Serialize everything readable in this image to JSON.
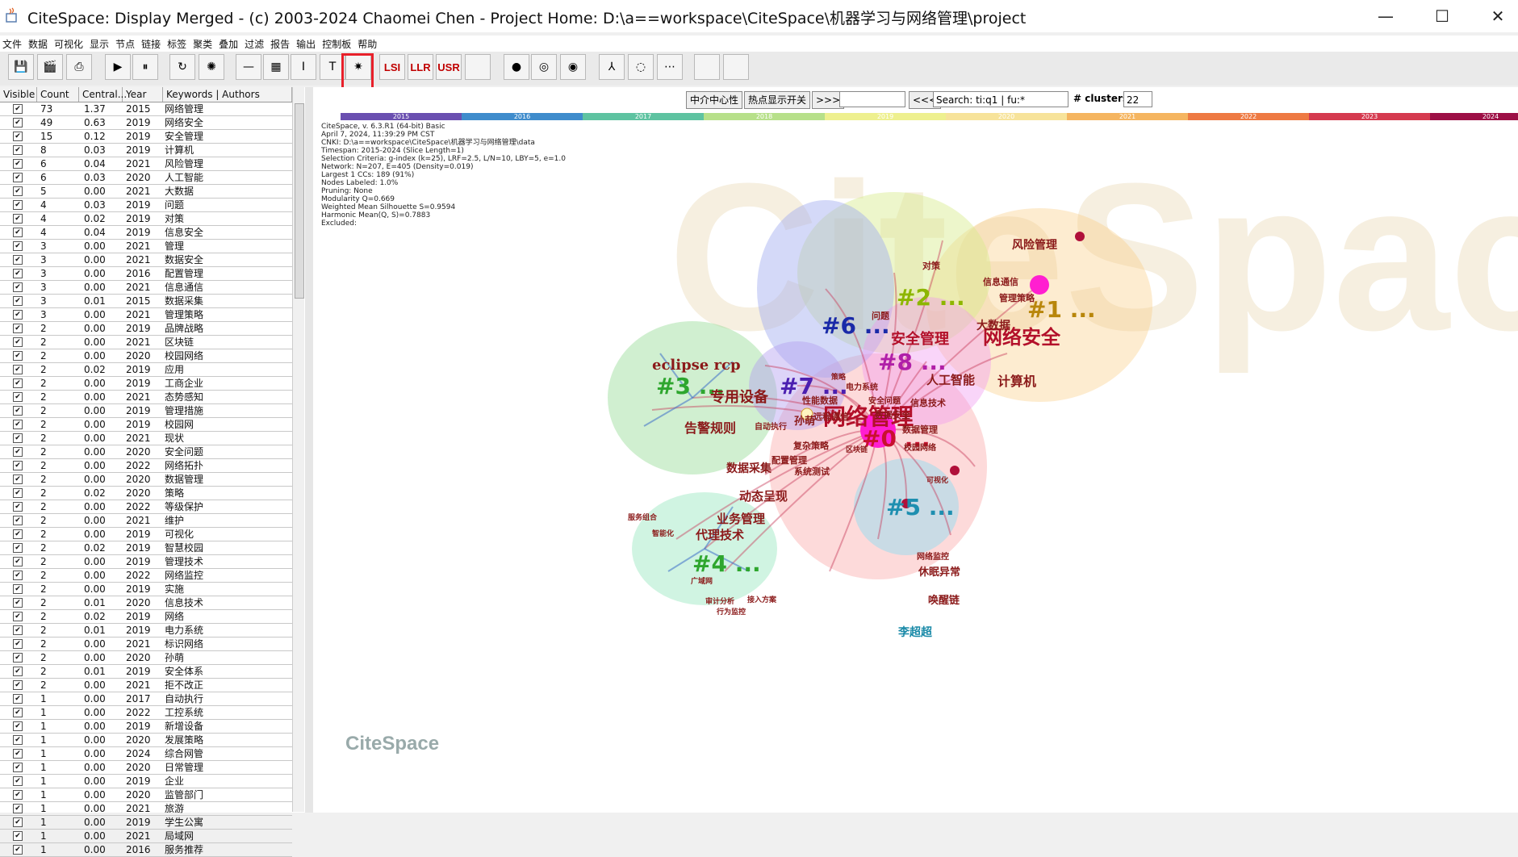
{
  "window": {
    "title": "CiteSpace: Display Merged - (c) 2003-2024 Chaomei Chen - Project Home: D:\\a==workspace\\CiteSpace\\机器学习与网络管理\\project",
    "controls": [
      "—",
      "☐",
      "✕"
    ]
  },
  "menu": [
    "文件",
    "数据",
    "可视化",
    "显示",
    "节点",
    "链接",
    "标签",
    "聚类",
    "叠加",
    "过滤",
    "报告",
    "输出",
    "控制板",
    "帮助"
  ],
  "toolbar": {
    "buttons": [
      {
        "name": "save-icon",
        "label": "💾"
      },
      {
        "name": "movie-icon",
        "label": "🎬"
      },
      {
        "name": "export-pdf-icon",
        "label": "⎙"
      },
      {
        "name": "play-icon",
        "label": "▶"
      },
      {
        "name": "pause-icon",
        "label": "⏸"
      },
      {
        "name": "refresh-icon",
        "label": "↻"
      },
      {
        "name": "starburst-icon",
        "label": "✺"
      },
      {
        "name": "line-icon",
        "label": "—"
      },
      {
        "name": "grid-icon",
        "label": "▦"
      },
      {
        "name": "resize-icon",
        "label": "I"
      },
      {
        "name": "text-icon",
        "label": "T"
      },
      {
        "name": "cluster-icon",
        "label": "✷"
      },
      {
        "name": "lsi-button",
        "label": "LSI"
      },
      {
        "name": "llr-button",
        "label": "LLR"
      },
      {
        "name": "usr-button",
        "label": "USR"
      },
      {
        "name": "blank-icon",
        "label": ""
      },
      {
        "name": "dots-icon",
        "label": "●"
      },
      {
        "name": "chain-icon",
        "label": "◎"
      },
      {
        "name": "target-icon",
        "label": "◉"
      },
      {
        "name": "tree-icon",
        "label": "⅄"
      },
      {
        "name": "spinner-icon",
        "label": "◌"
      },
      {
        "name": "timeline-icon",
        "label": "⋯"
      },
      {
        "name": "blank2-icon",
        "label": ""
      },
      {
        "name": "blank3-icon",
        "label": ""
      }
    ]
  },
  "table": {
    "headers": [
      "Visible",
      "Count",
      "Central...",
      "Year",
      "Keywords | Authors"
    ],
    "rows": [
      [
        "73",
        "1.37",
        "2015",
        "网络管理"
      ],
      [
        "49",
        "0.63",
        "2019",
        "网络安全"
      ],
      [
        "15",
        "0.12",
        "2019",
        "安全管理"
      ],
      [
        "8",
        "0.03",
        "2019",
        "计算机"
      ],
      [
        "6",
        "0.04",
        "2021",
        "风险管理"
      ],
      [
        "6",
        "0.03",
        "2020",
        "人工智能"
      ],
      [
        "5",
        "0.00",
        "2021",
        "大数据"
      ],
      [
        "4",
        "0.03",
        "2019",
        "问题"
      ],
      [
        "4",
        "0.02",
        "2019",
        "对策"
      ],
      [
        "4",
        "0.04",
        "2019",
        "信息安全"
      ],
      [
        "3",
        "0.00",
        "2021",
        "管理"
      ],
      [
        "3",
        "0.00",
        "2021",
        "数据安全"
      ],
      [
        "3",
        "0.00",
        "2016",
        "配置管理"
      ],
      [
        "3",
        "0.00",
        "2021",
        "信息通信"
      ],
      [
        "3",
        "0.01",
        "2015",
        "数据采集"
      ],
      [
        "3",
        "0.00",
        "2021",
        "管理策略"
      ],
      [
        "2",
        "0.00",
        "2019",
        "品牌战略"
      ],
      [
        "2",
        "0.00",
        "2021",
        "区块链"
      ],
      [
        "2",
        "0.00",
        "2020",
        "校园网络"
      ],
      [
        "2",
        "0.02",
        "2019",
        "应用"
      ],
      [
        "2",
        "0.00",
        "2019",
        "工商企业"
      ],
      [
        "2",
        "0.00",
        "2021",
        "态势感知"
      ],
      [
        "2",
        "0.00",
        "2019",
        "管理措施"
      ],
      [
        "2",
        "0.00",
        "2019",
        "校园网"
      ],
      [
        "2",
        "0.00",
        "2021",
        "现状"
      ],
      [
        "2",
        "0.00",
        "2020",
        "安全问题"
      ],
      [
        "2",
        "0.00",
        "2022",
        "网络拓扑"
      ],
      [
        "2",
        "0.00",
        "2020",
        "数据管理"
      ],
      [
        "2",
        "0.02",
        "2020",
        "策略"
      ],
      [
        "2",
        "0.00",
        "2022",
        "等级保护"
      ],
      [
        "2",
        "0.00",
        "2021",
        "维护"
      ],
      [
        "2",
        "0.00",
        "2019",
        "可视化"
      ],
      [
        "2",
        "0.02",
        "2019",
        "智慧校园"
      ],
      [
        "2",
        "0.00",
        "2019",
        "管理技术"
      ],
      [
        "2",
        "0.00",
        "2022",
        "网络监控"
      ],
      [
        "2",
        "0.00",
        "2019",
        "实施"
      ],
      [
        "2",
        "0.01",
        "2020",
        "信息技术"
      ],
      [
        "2",
        "0.02",
        "2019",
        "网络"
      ],
      [
        "2",
        "0.01",
        "2019",
        "电力系统"
      ],
      [
        "2",
        "0.00",
        "2021",
        "标识网络"
      ],
      [
        "2",
        "0.00",
        "2020",
        "孙萌"
      ],
      [
        "2",
        "0.01",
        "2019",
        "安全体系"
      ],
      [
        "2",
        "0.00",
        "2021",
        "拒不改正"
      ],
      [
        "1",
        "0.00",
        "2017",
        "自动执行"
      ],
      [
        "1",
        "0.00",
        "2022",
        "工控系统"
      ],
      [
        "1",
        "0.00",
        "2019",
        "新增设备"
      ],
      [
        "1",
        "0.00",
        "2020",
        "发展策略"
      ],
      [
        "1",
        "0.00",
        "2024",
        "综合网管"
      ],
      [
        "1",
        "0.00",
        "2020",
        "日常管理"
      ],
      [
        "1",
        "0.00",
        "2019",
        "企业"
      ],
      [
        "1",
        "0.00",
        "2020",
        "监管部门"
      ],
      [
        "1",
        "0.00",
        "2021",
        "旅游"
      ],
      [
        "1",
        "0.00",
        "2019",
        "学生公寓"
      ],
      [
        "1",
        "0.00",
        "2021",
        "局域网"
      ],
      [
        "1",
        "0.00",
        "2016",
        "服务推荐"
      ]
    ]
  },
  "search": {
    "betweenness_label": "中介中心性",
    "hotspot_label": "热点显示开关",
    "next_label": ">>>",
    "prev_label": "<<<",
    "search_value": "Search: ti:q1 | fu:*",
    "clusters_label": "# clusters",
    "clusters_value": "22"
  },
  "timeline": {
    "years": [
      "2015",
      "2016",
      "2017",
      "2018",
      "2019",
      "2020",
      "2021",
      "2022",
      "2023",
      "2024"
    ],
    "colors": [
      "#6a4fb0",
      "#3f8ccc",
      "#5ec3a1",
      "#b7e08a",
      "#eef08f",
      "#f7e39a",
      "#f5b560",
      "#ee7a43",
      "#d53a4f",
      "#9d1046"
    ]
  },
  "info_lines": [
    "CiteSpace, v. 6.3.R1 (64-bit) Basic",
    "April 7, 2024, 11:39:29 PM CST",
    "CNKI: D:\\a==workspace\\CiteSpace\\机器学习与网络管理\\data",
    "Timespan: 2015-2024 (Slice Length=1)",
    "Selection Criteria: g-index (k=25), LRF=2.5, L/N=10, LBY=5, e=1.0",
    "Network: N=207, E=405 (Density=0.019)",
    "Largest 1 CCs: 189 (91%)",
    "Nodes Labeled: 1.0%",
    "Pruning: None",
    "Modularity Q=0.669",
    "Weighted Mean Silhouette S=0.9594",
    "Harmonic Mean(Q, S)=0.7883",
    "Excluded:"
  ],
  "clusters": [
    {
      "label": "#0 ...",
      "color": "#c8102e"
    },
    {
      "label": "#1 ...",
      "color": "#b8860b"
    },
    {
      "label": "#2 ...",
      "color": "#8db600"
    },
    {
      "label": "#3 ...",
      "color": "#2ea62e"
    },
    {
      "label": "#4 ...",
      "color": "#2ea62e"
    },
    {
      "label": "#5 ...",
      "color": "#1e8fb0"
    },
    {
      "label": "#6 ...",
      "color": "#1a2aa8"
    },
    {
      "label": "#7 ...",
      "color": "#4b1fb0"
    },
    {
      "label": "#8 ...",
      "color": "#b01fa8"
    }
  ],
  "keywords": [
    "网络管理",
    "网络安全",
    "安全管理",
    "风险管理",
    "计算机",
    "大数据",
    "人工智能",
    "eclipse rcp",
    "专用设备",
    "告警规则",
    "数据采集",
    "动态呈现",
    "业务管理",
    "代理技术",
    "休眠异常",
    "唤醒链",
    "李超超",
    "孙萌",
    "对策",
    "问题",
    "信息通信",
    "管理策略",
    "性能数据",
    "远程通信",
    "复杂策略",
    "配置管理",
    "系统测试",
    "数据安全",
    "数据管理",
    "校园网络",
    "信息技术",
    "网络监控",
    "自动执行",
    "服务组合",
    "智能化",
    "广域网",
    "审计分析",
    "接入方案",
    "行为监控",
    "可视化",
    "安全问题",
    "电力系统",
    "策略",
    "区块链"
  ],
  "watermark": "CiteSpace"
}
